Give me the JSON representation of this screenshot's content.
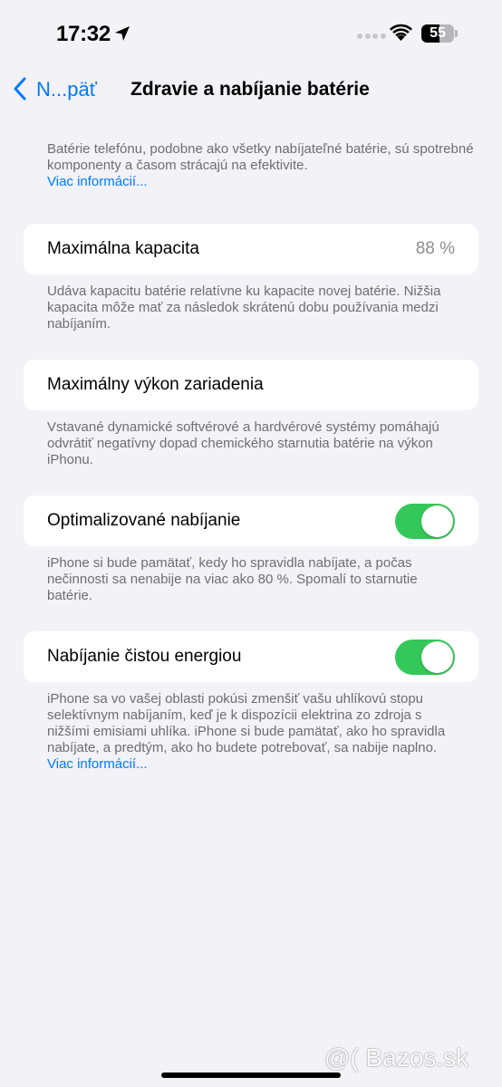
{
  "status_bar": {
    "time": "17:32",
    "battery_level": "55",
    "battery_percent": 55
  },
  "nav": {
    "back_label": "N...päť",
    "title": "Zdravie a nabíjanie batérie"
  },
  "intro": {
    "text": "Batérie telefónu, podobne ako všetky nabíjateľné batérie, sú spotrebné komponenty a časom strácajú na efektivite.",
    "link": "Viac informácií..."
  },
  "max_capacity": {
    "label": "Maximálna kapacita",
    "value": "88 %",
    "footer": "Udáva kapacitu batérie relatívne ku kapacite novej batérie. Nižšia kapacita môže mať za následok skrátenú dobu používania medzi nabíjaním."
  },
  "peak_performance": {
    "label": "Maximálny výkon zariadenia",
    "footer": "Vstavané dynamické softvérové a hardvérové systémy pomáhajú odvrátiť negatívny dopad chemického starnutia batérie na výkon iPhonu."
  },
  "optimized_charging": {
    "label": "Optimalizované nabíjanie",
    "enabled": true,
    "footer": "iPhone si bude pamätať, kedy ho spravidla nabíjate, a počas nečinnosti sa nenabije na viac ako 80 %. Spomalí to starnutie batérie."
  },
  "clean_energy_charging": {
    "label": "Nabíjanie čistou energiou",
    "enabled": true,
    "footer": "iPhone sa vo vašej oblasti pokúsi zmenšiť vašu uhlíkovú stopu selektívnym nabíjaním, keď je k dispozícii elektrina zo zdroja s nižšími emisiami uhlíka. iPhone si bude pamätať, ako ho spravidla nabíjate, a predtým, ako ho budete potrebovať, sa nabije naplno.",
    "link": "Viac informácií..."
  },
  "watermark": {
    "text": "@( Bazos.sk"
  },
  "colors": {
    "accent": "#007aff",
    "toggle_on": "#34c759",
    "background": "#f2f2f7"
  }
}
